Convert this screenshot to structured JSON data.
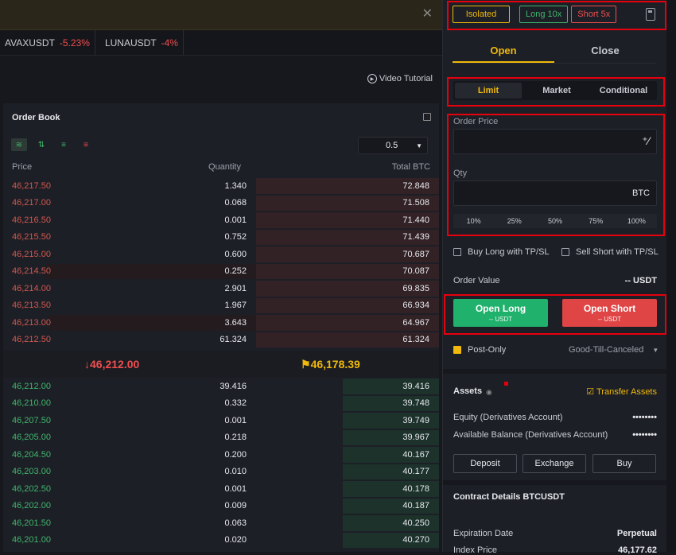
{
  "banner": {
    "close_icon": "close-icon"
  },
  "ticker": [
    {
      "symbol": "AVAXUSDT",
      "change": "-5.23%"
    },
    {
      "symbol": "LUNAUSDT",
      "change": "-4%"
    }
  ],
  "video_tutorial": "Video Tutorial",
  "orderbook": {
    "title": "Order Book",
    "precision": "0.5",
    "col_price": "Price",
    "col_qty": "Quantity",
    "col_total": "Total BTC",
    "asks": [
      {
        "price": "46,217.50",
        "qty": "1.340",
        "total": "72.848",
        "depth": 0.42,
        "qdepth": 0.0
      },
      {
        "price": "46,217.00",
        "qty": "0.068",
        "total": "71.508",
        "depth": 0.42,
        "qdepth": 0.0
      },
      {
        "price": "46,216.50",
        "qty": "0.001",
        "total": "71.440",
        "depth": 0.42,
        "qdepth": 0.0
      },
      {
        "price": "46,215.50",
        "qty": "0.752",
        "total": "71.439",
        "depth": 0.42,
        "qdepth": 0.0
      },
      {
        "price": "46,215.00",
        "qty": "0.600",
        "total": "70.687",
        "depth": 0.42,
        "qdepth": 0.0
      },
      {
        "price": "46,214.50",
        "qty": "0.252",
        "total": "70.087",
        "depth": 0.42,
        "qdepth": 0.83
      },
      {
        "price": "46,214.00",
        "qty": "2.901",
        "total": "69.835",
        "depth": 0.42,
        "qdepth": 0.0
      },
      {
        "price": "46,213.50",
        "qty": "1.967",
        "total": "66.934",
        "depth": 0.42,
        "qdepth": 0.0
      },
      {
        "price": "46,213.00",
        "qty": "3.643",
        "total": "64.967",
        "depth": 0.42,
        "qdepth": 0.82
      },
      {
        "price": "46,212.50",
        "qty": "61.324",
        "total": "61.324",
        "depth": 0.42,
        "qdepth": 0.0
      }
    ],
    "last_price": "46,212.00",
    "mark_price": "46,178.39",
    "bids": [
      {
        "price": "46,212.00",
        "qty": "39.416",
        "total": "39.416",
        "depth": 0.22
      },
      {
        "price": "46,210.00",
        "qty": "0.332",
        "total": "39.748",
        "depth": 0.22
      },
      {
        "price": "46,207.50",
        "qty": "0.001",
        "total": "39.749",
        "depth": 0.22
      },
      {
        "price": "46,205.00",
        "qty": "0.218",
        "total": "39.967",
        "depth": 0.22
      },
      {
        "price": "46,204.50",
        "qty": "0.200",
        "total": "40.167",
        "depth": 0.22
      },
      {
        "price": "46,203.00",
        "qty": "0.010",
        "total": "40.177",
        "depth": 0.22
      },
      {
        "price": "46,202.50",
        "qty": "0.001",
        "total": "40.178",
        "depth": 0.22
      },
      {
        "price": "46,202.00",
        "qty": "0.009",
        "total": "40.187",
        "depth": 0.22
      },
      {
        "price": "46,201.50",
        "qty": "0.063",
        "total": "40.250",
        "depth": 0.22
      },
      {
        "price": "46,201.00",
        "qty": "0.020",
        "total": "40.270",
        "depth": 0.22
      }
    ]
  },
  "trade": {
    "margin_mode": "Isolated",
    "long_leverage": "Long 10x",
    "short_leverage": "Short 5x",
    "tab_open": "Open",
    "tab_close": "Close",
    "order_types": [
      "Limit",
      "Market",
      "Conditional"
    ],
    "order_price_label": "Order Price",
    "qty_label": "Qty",
    "qty_unit": "BTC",
    "percents": [
      "10%",
      "25%",
      "50%",
      "75%",
      "100%"
    ],
    "buy_long_tpsl": "Buy Long with TP/SL",
    "sell_short_tpsl": "Sell Short with TP/SL",
    "order_value_label": "Order Value",
    "order_value": "-- USDT",
    "open_long": "Open Long",
    "open_long_sub": "-- USDT",
    "open_short": "Open Short",
    "open_short_sub": "-- USDT",
    "post_only": "Post-Only",
    "time_in_force": "Good-Till-Canceled"
  },
  "assets": {
    "title": "Assets",
    "transfer": "Transfer Assets",
    "equity_label": "Equity (Derivatives Account)",
    "equity_value": "••••••••",
    "available_label": "Available Balance (Derivatives Account)",
    "available_value": "••••••••",
    "deposit": "Deposit",
    "exchange": "Exchange",
    "buy": "Buy"
  },
  "contract": {
    "title": "Contract Details BTCUSDT",
    "expiration_label": "Expiration Date",
    "expiration_value": "Perpetual",
    "index_label": "Index Price",
    "index_value": "46,177.62"
  }
}
